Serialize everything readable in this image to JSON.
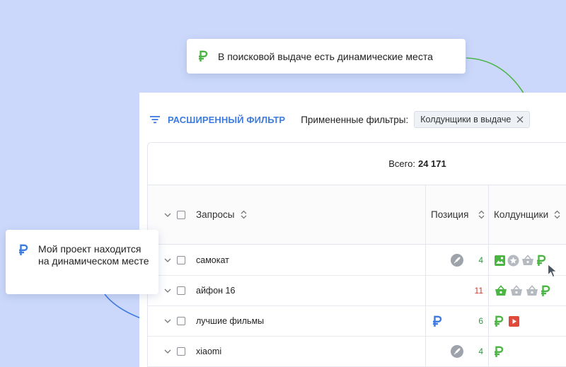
{
  "callouts": {
    "dynamic_places": "В поисковой выдаче есть динамические места",
    "my_project": "Мой проект находится на динамическом месте"
  },
  "filter": {
    "button_label": "РАСШИРЕННЫЙ ФИЛЬТР",
    "applied_label": "Примененные фильтры:",
    "chip_label": "Колдунщики в выдаче"
  },
  "summary": {
    "total_label": "Всего:",
    "total_value": "24 171"
  },
  "table": {
    "headers": {
      "query": "Запросы",
      "position": "Позиция",
      "wizards": "Колдунщики"
    },
    "rows": [
      {
        "query": "самокат",
        "position": "4",
        "position_color": "#2e9a3e",
        "position_icon": "rocket-icon",
        "wizards": [
          "gallery-icon",
          "star-icon",
          "basket-icon",
          "ruble-icon"
        ]
      },
      {
        "query": "айфон 16",
        "position": "11",
        "position_color": "#d13b34",
        "position_icon": "",
        "wizards": [
          "basket-icon",
          "basket-icon",
          "basket-icon",
          "ruble-icon"
        ]
      },
      {
        "query": "лучшие фильмы",
        "position": "6",
        "position_color": "#2e9a3e",
        "position_icon": "ruble-icon",
        "wizards": [
          "ruble-icon",
          "video-icon"
        ]
      },
      {
        "query": "xiaomi",
        "position": "4",
        "position_color": "#2e9a3e",
        "position_icon": "rocket-icon",
        "wizards": [
          "ruble-icon"
        ]
      }
    ]
  },
  "colors": {
    "accent": "#3d7be0",
    "green": "#4bb543",
    "background": "#cbd8fb"
  }
}
